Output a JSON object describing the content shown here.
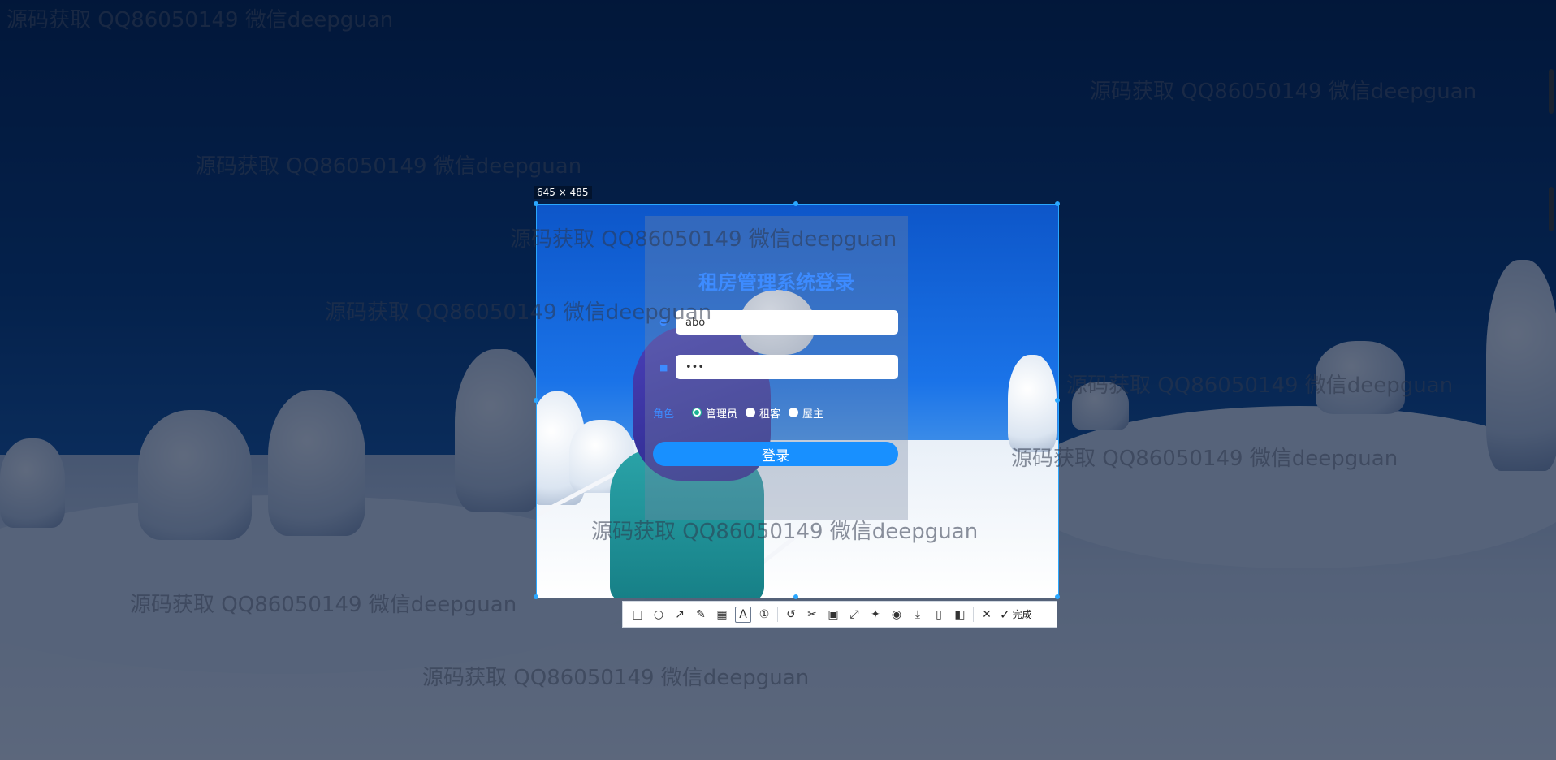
{
  "selection": {
    "size_label": "645 × 485"
  },
  "login": {
    "title": "租房管理系统登录",
    "username_value": "abo",
    "password_value": "•••",
    "role_label": "角色",
    "roles": [
      "管理员",
      "租客",
      "屋主"
    ],
    "selected_role": "管理员",
    "submit_label": "登录"
  },
  "toolbar": {
    "tools": [
      "rectangle-icon",
      "ellipse-icon",
      "arrow-icon",
      "pencil-icon",
      "mosaic-icon",
      "text-icon",
      "number-marker-icon",
      "undo-icon",
      "scissors-icon",
      "ocr-icon",
      "scroll-capture-icon",
      "pin-icon",
      "record-icon",
      "download-icon",
      "save-icon",
      "bookmark-icon",
      "close-icon"
    ],
    "active_tool": "text-icon",
    "done_label": "完成"
  },
  "watermark_text": "源码获取 QQ86050149 微信deepguan",
  "colors": {
    "accent": "#1890ff",
    "title": "#3d8bff",
    "radio_checked": "#1ab394",
    "selection_border": "#2aa7ff"
  }
}
